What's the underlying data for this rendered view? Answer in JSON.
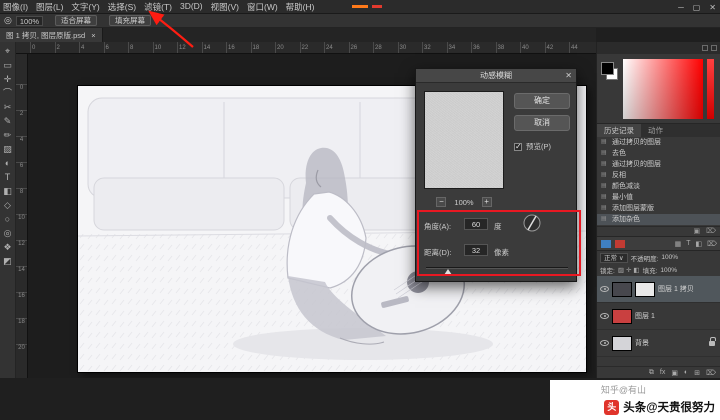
{
  "menu_bar": {
    "items": [
      "图像(I)",
      "图层(L)",
      "文字(Y)",
      "选择(S)",
      "滤镜(T)",
      "3D(D)",
      "视图(V)",
      "窗口(W)",
      "帮助(H)"
    ],
    "window_controls": [
      "─",
      "▢",
      "✕"
    ]
  },
  "options_bar": {
    "tool_icon": "◎",
    "zoom_value": "100%",
    "fit_screen_button": "适合屏幕",
    "fill_screen_button": "填充屏幕",
    "right_icons": [
      "▤",
      "⊞"
    ]
  },
  "document_tab": {
    "title": "图 1 拷贝, 图层原版.psd",
    "close_icon": "×"
  },
  "toolbar": {
    "icons": [
      "⌖",
      "▭",
      "✛",
      "⌒",
      "✂",
      "✎",
      "✏",
      "▨",
      "◐",
      "T",
      "◧",
      "◇",
      "○",
      "◎",
      "❖",
      "◩"
    ]
  },
  "rulers": {
    "horizontal": [
      "0",
      "2",
      "4",
      "6",
      "8",
      "10",
      "12",
      "14",
      "16",
      "18",
      "20",
      "22",
      "24",
      "26",
      "28",
      "30",
      "32",
      "34",
      "36",
      "38",
      "40",
      "42",
      "44"
    ],
    "vertical": [
      "0",
      "2",
      "4",
      "6",
      "8",
      "10",
      "12",
      "14",
      "16",
      "18",
      "20"
    ]
  },
  "dialog": {
    "title": "动感模糊",
    "close_icon": "✕",
    "ok_button": "确定",
    "cancel_button": "取消",
    "preview_checkbox": "预览(P)",
    "zoom_out": "−",
    "zoom_value": "100%",
    "zoom_in": "+",
    "angle_label": "角度(A):",
    "angle_value": "60",
    "angle_unit": "度",
    "distance_label": "距离(D):",
    "distance_value": "32",
    "distance_unit": "像素"
  },
  "annotations": {
    "arrow_color": "#ff1d12",
    "box_color": "#e81822"
  },
  "panels": {
    "history": {
      "tab_history": "历史记录",
      "tab_actions": "动作",
      "items": [
        "通过拷贝的图层",
        "去色",
        "通过拷贝的图层",
        "反相",
        "颜色减淡",
        "最小值",
        "添加图层蒙版",
        "添加杂色"
      ],
      "footer_icons": [
        "▣",
        "⌦"
      ]
    },
    "strip_icons": [
      "▦",
      "T",
      "◧",
      "⌦"
    ],
    "layers": {
      "blend_mode": "正常",
      "caret_icon": "∨",
      "opacity_label": "不透明度:",
      "opacity_value": "100%",
      "lock_label": "锁定:",
      "lock_icons": [
        "▨",
        "✛",
        "◧"
      ],
      "fill_label": "填充:",
      "fill_value": "100%",
      "items": [
        {
          "name": "图层 1 拷贝"
        },
        {
          "name": "图层 1"
        },
        {
          "name": "背景"
        }
      ],
      "footer_icons": [
        "⧉",
        "fx",
        "▣",
        "◐",
        "⊞",
        "⌦"
      ]
    }
  },
  "watermark": {
    "zhihu": "知乎@有山",
    "toutiao": "头条@天贵很努力",
    "logo_char": "头"
  }
}
